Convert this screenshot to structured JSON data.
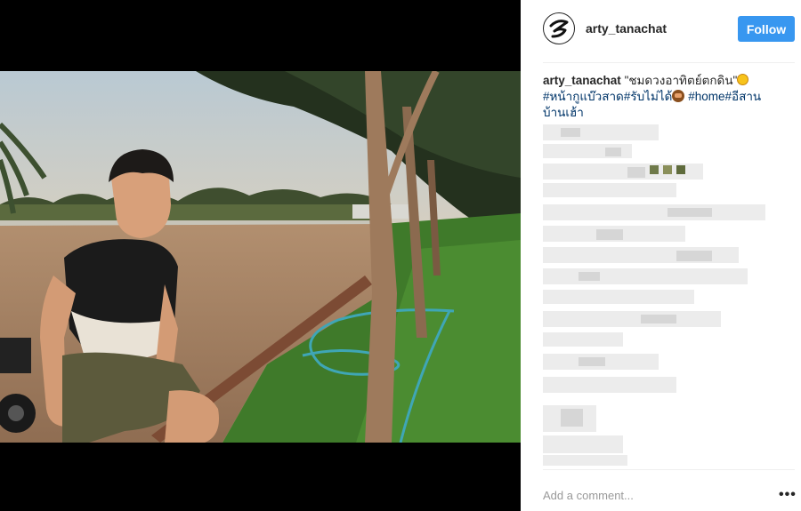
{
  "post": {
    "username": "arty_tanachat",
    "follow_label": "Follow",
    "caption": {
      "username": "arty_tanachat",
      "quote": "\"ชมดวงอาทิตย์ตกดิน\"",
      "hashtags": [
        "#หน้ากูแบ๊วสาด",
        "#รับไม่ได้",
        "#home",
        "#อีสาน",
        "บ้านเฮ้า"
      ],
      "emojis": [
        "sun-emoji",
        "see-no-evil-monkey-emoji"
      ]
    },
    "comment_placeholder": "Add a comment...",
    "more_label": "•••"
  },
  "colors": {
    "follow_button": "#3897f0",
    "username_text": "#262626",
    "hashtag_link": "#003569",
    "placeholder": "#999999",
    "media_background": "#000000"
  },
  "icons": {
    "avatar": "stylized-s-logo-icon",
    "more": "more-options-icon"
  }
}
